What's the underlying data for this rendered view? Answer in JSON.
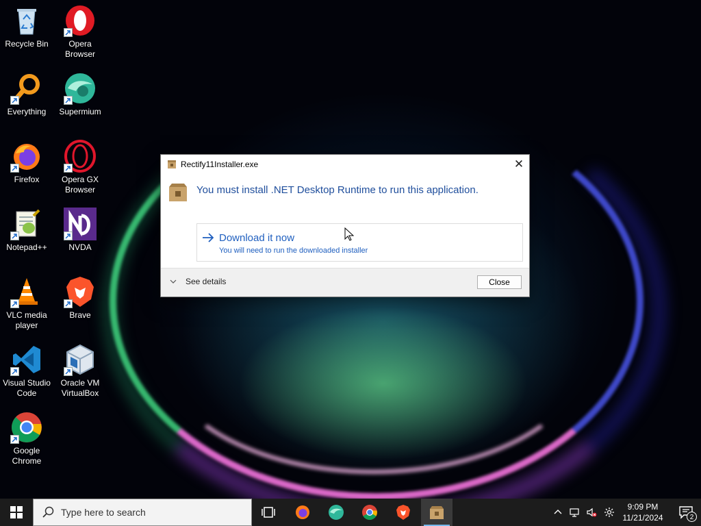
{
  "desktop": {
    "icons": [
      {
        "label": "Recycle Bin"
      },
      {
        "label": "Opera Browser"
      },
      {
        "label": "Everything"
      },
      {
        "label": "Supermium"
      },
      {
        "label": "Firefox"
      },
      {
        "label": "Opera GX Browser"
      },
      {
        "label": "Notepad++"
      },
      {
        "label": "NVDA"
      },
      {
        "label": "VLC media player"
      },
      {
        "label": "Brave"
      },
      {
        "label": "Visual Studio Code"
      },
      {
        "label": "Oracle VM VirtualBox"
      },
      {
        "label": "Google Chrome"
      }
    ]
  },
  "dialog": {
    "title": "Rectify11Installer.exe",
    "close_glyph": "✕",
    "message": "You must install .NET Desktop Runtime to run this application.",
    "command": {
      "title": "Download it now",
      "subtitle": "You will need to run the downloaded installer"
    },
    "details_label": "See details",
    "close_button": "Close"
  },
  "taskbar": {
    "search_placeholder": "Type here to search",
    "time": "9:09 PM",
    "date": "11/21/2024",
    "notification_count": "2"
  },
  "colors": {
    "accent_link": "#1f5fbf",
    "message_text": "#1f4e9c",
    "taskbar_bg": "#1c1c1c"
  }
}
